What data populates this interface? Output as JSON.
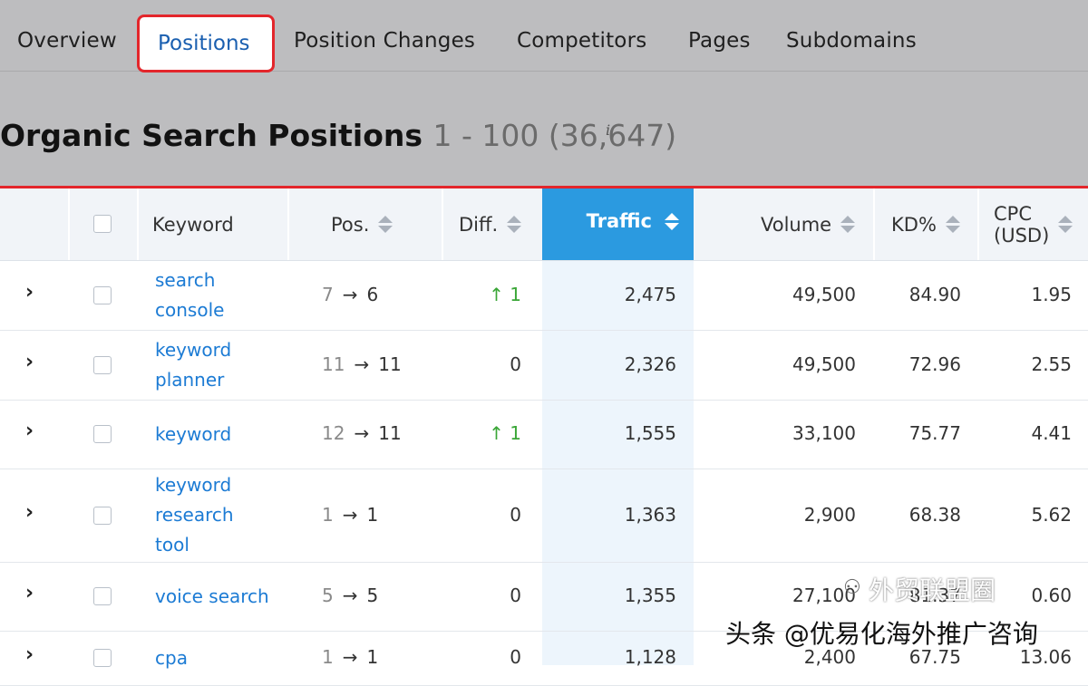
{
  "tabs": [
    {
      "label": "Overview"
    },
    {
      "label": "Positions",
      "active": true
    },
    {
      "label": "Position Changes"
    },
    {
      "label": "Competitors"
    },
    {
      "label": "Pages"
    },
    {
      "label": "Subdomains"
    }
  ],
  "title": {
    "main": "Organic Search Positions",
    "range": "1 - 100 (36,647)",
    "info": "i"
  },
  "columns": {
    "keyword": "Keyword",
    "pos": "Pos.",
    "diff": "Diff.",
    "traffic": "Traffic",
    "volume": "Volume",
    "kd": "KD%",
    "cpc_line1": "CPC",
    "cpc_line2": "(USD)"
  },
  "rows": [
    {
      "keyword_lines": [
        "search",
        "console"
      ],
      "pos_from": "7",
      "pos_to": "6",
      "diff": "↑ 1",
      "traffic": "2,475",
      "volume": "49,500",
      "kd": "84.90",
      "cpc": "1.95"
    },
    {
      "keyword_lines": [
        "keyword",
        "planner"
      ],
      "pos_from": "11",
      "pos_to": "11",
      "diff": "0",
      "traffic": "2,326",
      "volume": "49,500",
      "kd": "72.96",
      "cpc": "2.55"
    },
    {
      "keyword_lines": [
        "keyword"
      ],
      "pos_from": "12",
      "pos_to": "11",
      "diff": "↑ 1",
      "traffic": "1,555",
      "volume": "33,100",
      "kd": "75.77",
      "cpc": "4.41"
    },
    {
      "keyword_lines": [
        "keyword",
        "research",
        "tool"
      ],
      "pos_from": "1",
      "pos_to": "1",
      "diff": "0",
      "traffic": "1,363",
      "volume": "2,900",
      "kd": "68.38",
      "cpc": "5.62"
    },
    {
      "keyword_lines": [
        "voice search"
      ],
      "pos_from": "5",
      "pos_to": "5",
      "diff": "0",
      "traffic": "1,355",
      "volume": "27,100",
      "kd": "81.37",
      "cpc": "0.60"
    },
    {
      "keyword_lines": [
        "cpa"
      ],
      "pos_from": "1",
      "pos_to": "1",
      "diff": "0",
      "traffic": "1,128",
      "volume": "2,400",
      "kd": "67.75",
      "cpc": "13.06"
    }
  ],
  "arrow_glyph": "→",
  "chevron_glyph": "›",
  "watermark": {
    "line1": "外贸联盟圈",
    "line2": "头条 @优易化海外推广咨询"
  },
  "colors": {
    "accent_blue": "#2b9ae0",
    "link_blue": "#1c7bd4",
    "highlight_red": "#e3262b",
    "positive_green": "#3aa637"
  }
}
